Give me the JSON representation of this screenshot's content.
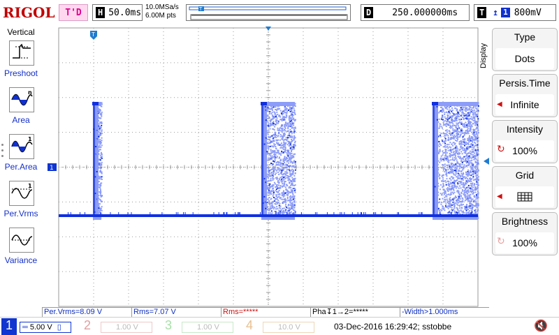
{
  "app": {
    "logo": "RIGOL"
  },
  "topbar": {
    "trigger_state": "T'D",
    "timebase_tag": "H",
    "timebase_value": "50.0ms",
    "sample_rate": "10.0MSa/s",
    "memory_depth": "6.00M pts",
    "memory_strip_marker": "T",
    "delay_tag": "D",
    "delay_value": "250.000000ms",
    "trigger_tag": "T",
    "trigger_slope_icon": "rising-edge-icon",
    "trigger_channel": "1",
    "trigger_level": "800mV"
  },
  "left_panel": {
    "title": "Vertical",
    "items": [
      {
        "label": "Preshoot",
        "icon": "preshoot-icon"
      },
      {
        "label": "Area",
        "icon": "area-icon"
      },
      {
        "label": "Per.Area",
        "icon": "period-area-icon"
      },
      {
        "label": "Per.Vrms",
        "icon": "period-vrms-icon"
      },
      {
        "label": "Variance",
        "icon": "variance-icon"
      }
    ]
  },
  "grid": {
    "markers": {
      "trigger_position": "T",
      "channel1_ground": "1"
    },
    "colors": {
      "trace": "#1030e0",
      "persistence": "#8c9cf8",
      "grid": "#9a9a9a"
    }
  },
  "right_menu": {
    "tab_label": "Display",
    "items": [
      {
        "title": "Type",
        "value": "Dots"
      },
      {
        "title": "Persis.Time",
        "value": "Infinite"
      },
      {
        "title": "Intensity",
        "value": "100%"
      },
      {
        "title": "Grid",
        "value": "grid-full-icon"
      },
      {
        "title": "Brightness",
        "value": "100%"
      }
    ]
  },
  "measurements": [
    {
      "text": "Per.Vrms=8.09 V",
      "color": "#1030c0"
    },
    {
      "text": "Rms=7.07 V",
      "color": "#1030c0"
    },
    {
      "text": "Rms=*****",
      "color": "#d01010"
    },
    {
      "text": "Pha↧1→2=*****",
      "color": "#000000"
    },
    {
      "text": "-Width>1.000ms",
      "color": "#1030c0"
    }
  ],
  "channels": [
    {
      "num": "1",
      "scale": "5.00 V",
      "color": "#1035d0",
      "active": true
    },
    {
      "num": "2",
      "scale": "1.00 V",
      "color": "#e0a0a0",
      "active": false
    },
    {
      "num": "3",
      "scale": "1.00 V",
      "color": "#a8e0a8",
      "active": false
    },
    {
      "num": "4",
      "scale": "10.0 V",
      "color": "#e8c090",
      "active": false
    }
  ],
  "status": {
    "datetime_user": "03-Dec-2016 16:29:42; sstobbe",
    "speaker_icon": "speaker-muted-icon"
  }
}
